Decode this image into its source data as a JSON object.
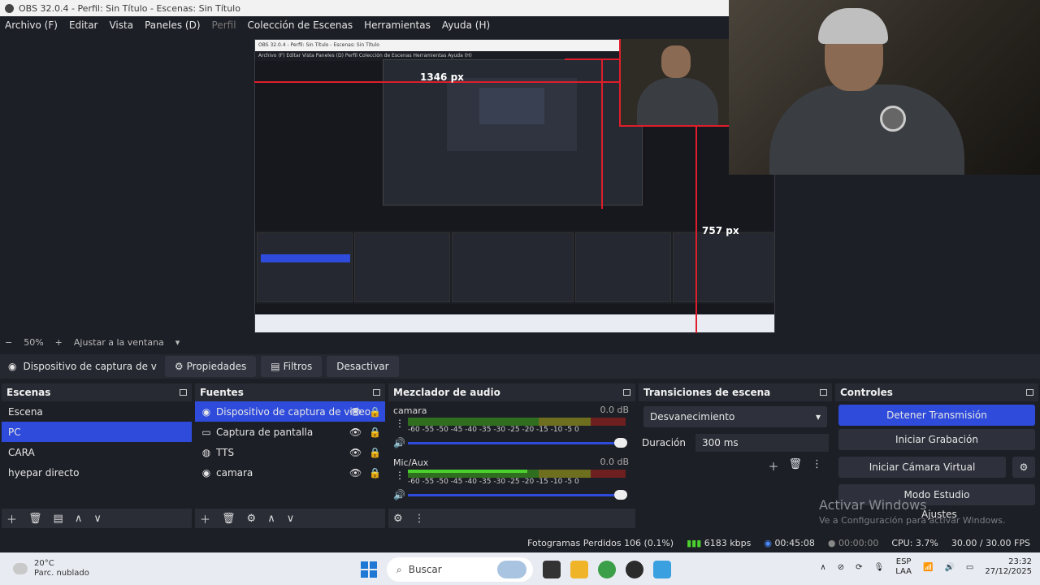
{
  "window": {
    "title": "OBS 32.0.4 - Perfil: Sin Título - Escenas: Sin Título"
  },
  "menu": [
    "Archivo (F)",
    "Editar",
    "Vista",
    "Paneles (D)",
    "Perfil",
    "Colección de Escenas",
    "Herramientas",
    "Ayuda (H)"
  ],
  "preview": {
    "label_width": "1346 px",
    "label_height": "757 px",
    "mini_title": "OBS 32.0.4 - Perfil: Sin Título - Escenas: Sin Título",
    "mini_menu": "Archivo (F)   Editar   Vista   Paneles (D)   Perfil   Colección de Escenas   Herramientas   Ayuda (H)"
  },
  "zoom": {
    "minus": "−",
    "value": "50%",
    "plus": "+",
    "fit": "Ajustar a la ventana",
    "caret": "▾"
  },
  "source_toolbar": {
    "source": "Dispositivo de captura de v",
    "properties": "Propiedades",
    "filters": "Filtros",
    "deactivate": "Desactivar"
  },
  "scenes": {
    "title": "Escenas",
    "items": [
      "Escena",
      "PC",
      "CARA",
      "hyepar directo"
    ],
    "selected": 1
  },
  "sources": {
    "title": "Fuentes",
    "items": [
      {
        "icon": "camera-icon",
        "glyph": "◉",
        "label": "Dispositivo de captura de video"
      },
      {
        "icon": "monitor-icon",
        "glyph": "▭",
        "label": "Captura de pantalla"
      },
      {
        "icon": "tts-icon",
        "glyph": "◍",
        "label": "TTS"
      },
      {
        "icon": "camera-icon",
        "glyph": "◉",
        "label": "camara"
      }
    ],
    "selected": 0
  },
  "mixer": {
    "title": "Mezclador de audio",
    "channels": [
      {
        "name": "camara",
        "db": "0.0 dB",
        "level": 0.0
      },
      {
        "name": "Mic/Aux",
        "db": "0.0 dB",
        "level": 0.55
      }
    ],
    "ticks": "-60   -55   -50   -45   -40   -35   -30   -25   -20   -15   -10    -5     0"
  },
  "transitions": {
    "title": "Transiciones de escena",
    "selected": "Desvanecimiento",
    "duration_label": "Duración",
    "duration_value": "300 ms"
  },
  "controls": {
    "title": "Controles",
    "buttons": [
      "Detener Transmisión",
      "Iniciar Grabación",
      "Iniciar Cámara Virtual",
      "Modo Estudio",
      "Ajustes"
    ]
  },
  "watermark": {
    "line1": "Activar Windows",
    "line2": "Ve a Configuración para activar Windows."
  },
  "status": {
    "dropped": "Fotogramas Perdidos 106 (0.1%)",
    "bitrate": "6183 kbps",
    "stream_time": "00:45:08",
    "rec_time": "00:00:00",
    "cpu": "CPU: 3.7%",
    "fps": "30.00 / 30.00 FPS"
  },
  "taskbar": {
    "temp": "20°C",
    "weather": "Parc. nublado",
    "search": "Buscar",
    "lang1": "ESP",
    "lang2": "LAA",
    "time": "23:32",
    "date": "27/12/2025"
  },
  "colors": {
    "accent": "#2e4bdb",
    "red_guide": "#e01e2b"
  }
}
